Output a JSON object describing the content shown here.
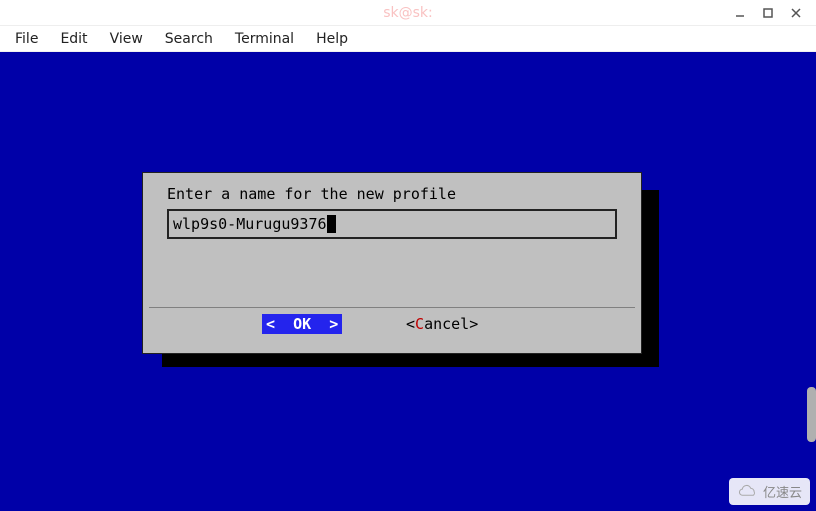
{
  "window": {
    "title": "sk@sk:"
  },
  "menubar": {
    "items": [
      "File",
      "Edit",
      "View",
      "Search",
      "Terminal",
      "Help"
    ]
  },
  "dialog": {
    "prompt": "Enter a name for the new profile",
    "input_value": "wlp9s0-Murugu9376",
    "ok_label": "<  OK  >",
    "cancel_lt": "<",
    "cancel_hotkey": "C",
    "cancel_rest": "ancel>",
    "plain_cancel": "<Cancel>"
  },
  "watermark": {
    "text": "亿速云"
  }
}
